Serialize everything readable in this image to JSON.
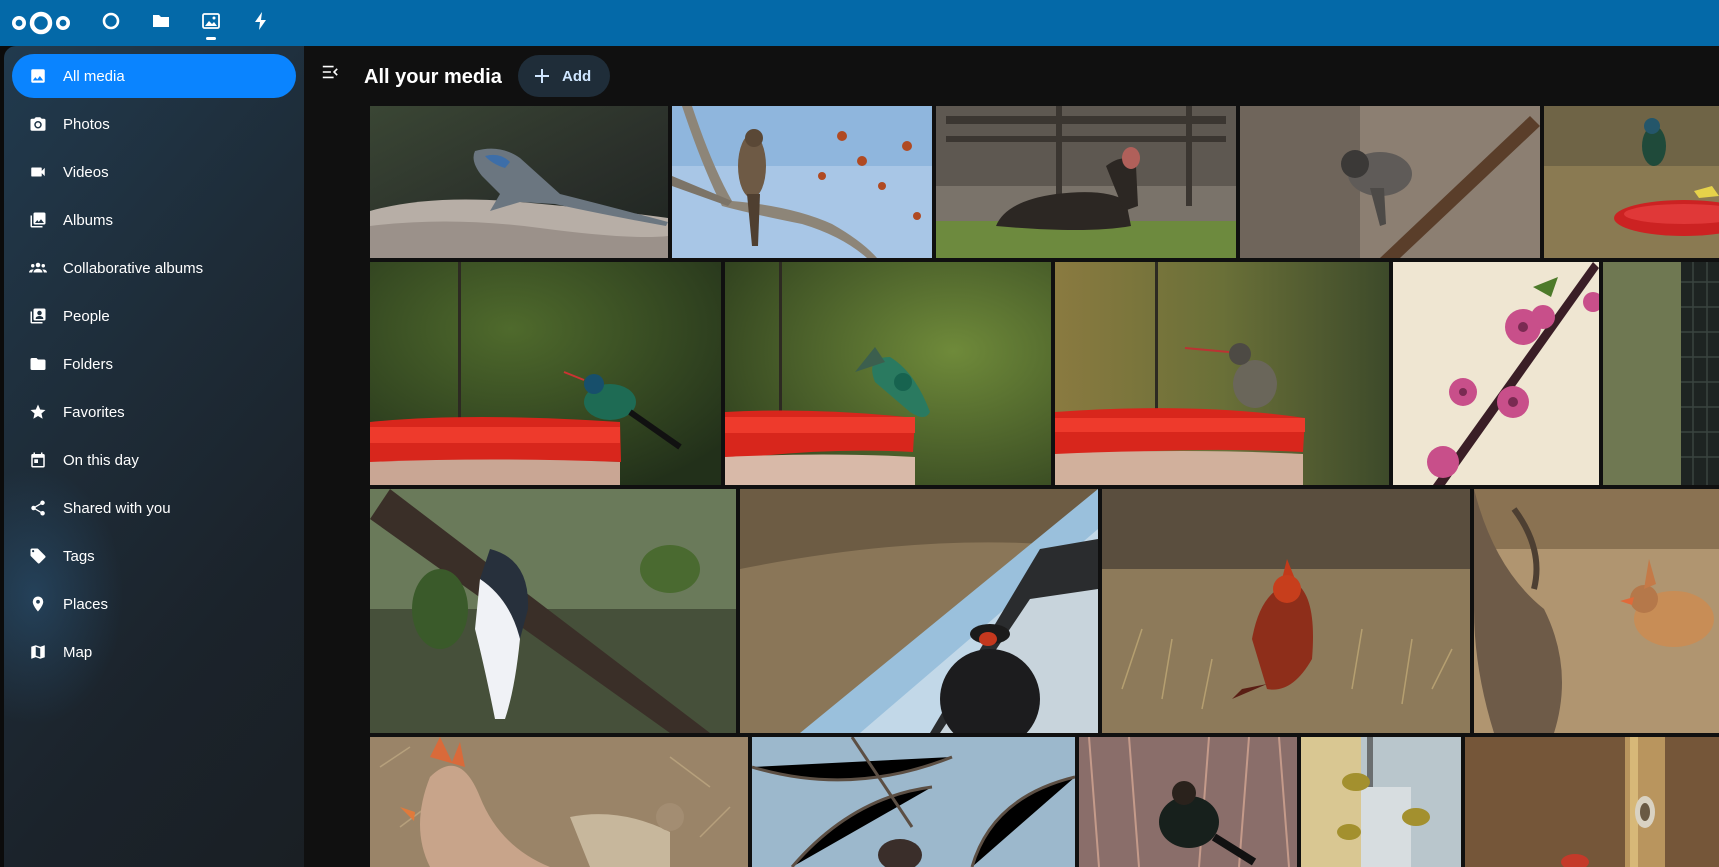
{
  "header": {
    "apps": [
      {
        "name": "dashboard",
        "icon": "circle-icon"
      },
      {
        "name": "files",
        "icon": "folder-icon"
      },
      {
        "name": "photos",
        "icon": "image-icon",
        "active": true
      },
      {
        "name": "activity",
        "icon": "bolt-icon"
      }
    ],
    "accent": "#0469a8"
  },
  "sidebar": {
    "items": [
      {
        "label": "All media",
        "icon": "image-icon",
        "active": true
      },
      {
        "label": "Photos",
        "icon": "camera-icon"
      },
      {
        "label": "Videos",
        "icon": "video-icon"
      },
      {
        "label": "Albums",
        "icon": "albums-icon"
      },
      {
        "label": "Collaborative albums",
        "icon": "people-group-icon"
      },
      {
        "label": "People",
        "icon": "person-portrait-icon"
      },
      {
        "label": "Folders",
        "icon": "folder-icon"
      },
      {
        "label": "Favorites",
        "icon": "star-icon"
      },
      {
        "label": "On this day",
        "icon": "calendar-icon"
      },
      {
        "label": "Shared with you",
        "icon": "share-icon"
      },
      {
        "label": "Tags",
        "icon": "tag-icon"
      },
      {
        "label": "Places",
        "icon": "map-marker-icon"
      },
      {
        "label": "Map",
        "icon": "map-icon"
      }
    ],
    "active_color": "#0a84ff"
  },
  "main": {
    "title": "All your media",
    "add_label": "Add"
  },
  "photos": [
    {
      "subject": "lizard on rock"
    },
    {
      "subject": "hawk on branch"
    },
    {
      "subject": "wild turkey"
    },
    {
      "subject": "junco on branch"
    },
    {
      "subject": "hummingbird at feeder"
    },
    {
      "subject": "hummingbird at feeder"
    },
    {
      "subject": "hummingbird in flight"
    },
    {
      "subject": "hummingbird perched"
    },
    {
      "subject": "pink blossoms"
    },
    {
      "subject": "bird feeder"
    },
    {
      "subject": "nuthatch on trunk"
    },
    {
      "subject": "bird on car mirror"
    },
    {
      "subject": "cardinal on ground"
    },
    {
      "subject": "female cardinal"
    },
    {
      "subject": "cardinal and sparrow"
    },
    {
      "subject": "bird in branches"
    },
    {
      "subject": "cowbird"
    },
    {
      "subject": "finches on feeder"
    },
    {
      "subject": "feeder pole"
    }
  ]
}
